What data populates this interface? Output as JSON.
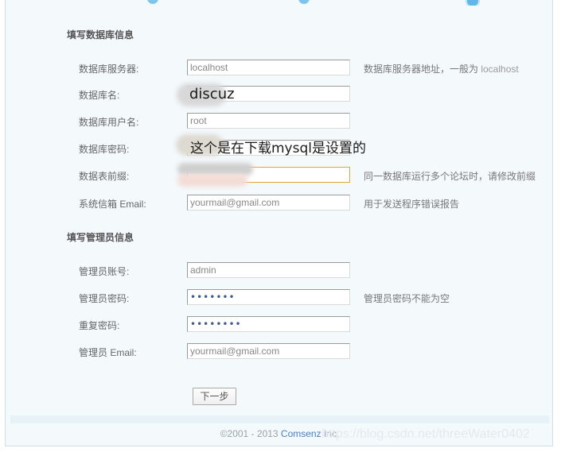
{
  "page": {
    "background_color": "#f4f9fc",
    "container_border_color": "#cfdfe8"
  },
  "sections": {
    "database": {
      "title": "填写数据库信息",
      "rows": [
        {
          "label": "数据库服务器:",
          "value": "localhost",
          "type": "text",
          "hint_prefix": "数据库服务器地址，一般为 ",
          "hint_emphasis": "localhost",
          "focused": false
        },
        {
          "label": "数据库名:",
          "value": "",
          "type": "text",
          "hint_prefix": "",
          "hint_emphasis": "",
          "focused": false
        },
        {
          "label": "数据库用户名:",
          "value": "root",
          "type": "text",
          "hint_prefix": "",
          "hint_emphasis": "",
          "focused": false
        },
        {
          "label": "数据库密码:",
          "value": "",
          "type": "password",
          "hint_prefix": "",
          "hint_emphasis": "",
          "focused": false
        },
        {
          "label": "数据表前缀:",
          "value": "",
          "type": "text",
          "hint_prefix": "同一数据库运行多个论坛时，请修改前缀",
          "hint_emphasis": "",
          "focused": true
        },
        {
          "label": "系统信箱 Email:",
          "value": "yourmail@gmail.com",
          "type": "text",
          "hint_prefix": "用于发送程序错误报告",
          "hint_emphasis": "",
          "focused": false
        }
      ]
    },
    "admin": {
      "title": "填写管理员信息",
      "rows": [
        {
          "label": "管理员账号:",
          "value": "admin",
          "type": "text",
          "hint_prefix": "",
          "hint_emphasis": "",
          "focused": false
        },
        {
          "label": "管理员密码:",
          "value": "•••••••",
          "type": "password",
          "hint_prefix": "管理员密码不能为空",
          "hint_emphasis": "",
          "focused": false
        },
        {
          "label": "重复密码:",
          "value": "••••••••",
          "type": "password",
          "hint_prefix": "",
          "hint_emphasis": "",
          "focused": false
        },
        {
          "label": "管理员 Email:",
          "value": "yourmail@gmail.com",
          "type": "text",
          "hint_prefix": "",
          "hint_emphasis": "",
          "focused": false
        }
      ]
    }
  },
  "submit": {
    "next_label": "下一步"
  },
  "footer": {
    "copyright_prefix": "©2001 - 2013 ",
    "company": "Comsenz",
    "copyright_suffix": " Inc."
  },
  "watermark": {
    "text": "https://blog.csdn.net/threeWater0402"
  },
  "annotations": [
    {
      "text": "discuz"
    },
    {
      "text": "这个是在下载mysql是设置的"
    }
  ]
}
